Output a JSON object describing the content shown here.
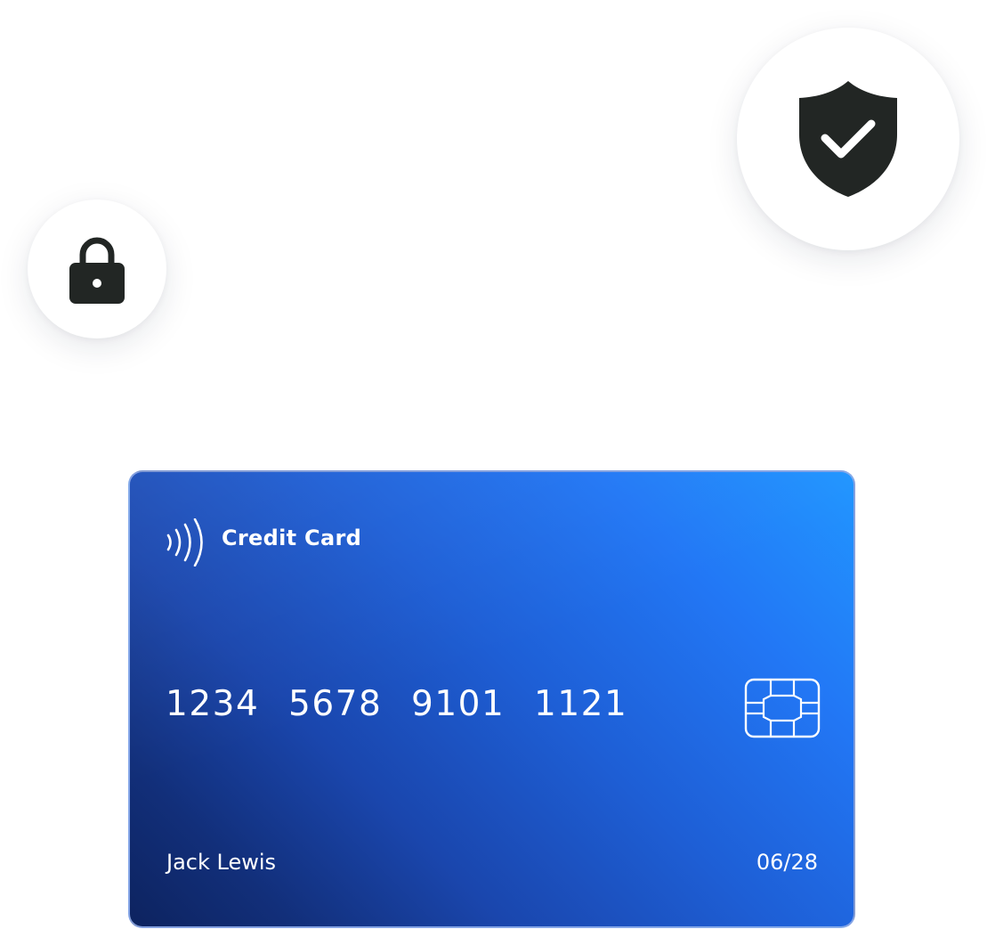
{
  "badges": {
    "shield": {
      "icon": "shield-check-icon",
      "color": "#222624"
    },
    "lock": {
      "icon": "lock-icon",
      "color": "#222624"
    }
  },
  "card": {
    "title": "Credit Card",
    "number_groups": [
      "1234",
      "5678",
      "9101",
      "1121"
    ],
    "holder_name": "Jack Lewis",
    "expiry": "06/28",
    "contactless_icon": "contactless-icon",
    "chip_icon": "chip-icon",
    "colors": {
      "gradient_light": "#2196ff",
      "gradient_dark": "#0d235f",
      "text": "#ffffff"
    }
  }
}
